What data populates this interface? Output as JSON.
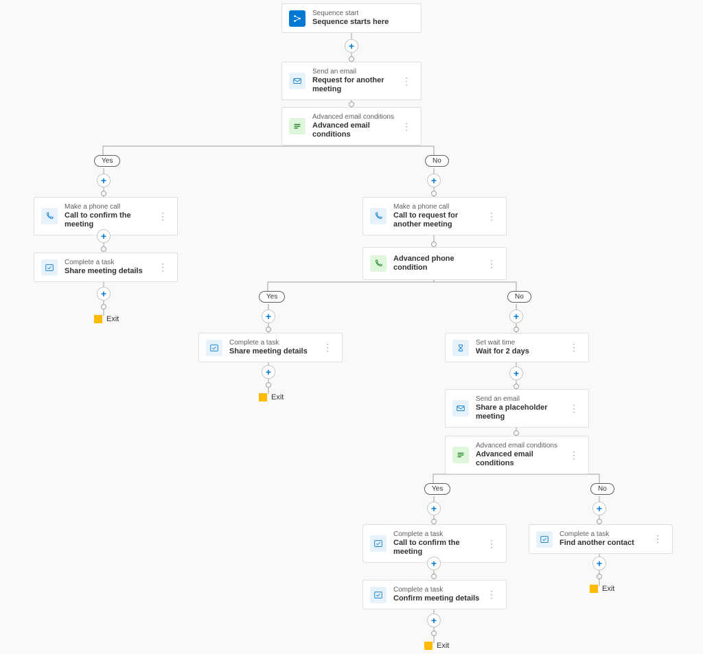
{
  "labels": {
    "yes": "Yes",
    "no": "No",
    "exit": "Exit"
  },
  "nodes": {
    "start": {
      "pre": "Sequence start",
      "title": "Sequence starts here"
    },
    "email1": {
      "pre": "Send an email",
      "title": "Request for another meeting"
    },
    "cond1": {
      "pre": "Advanced email conditions",
      "title": "Advanced email conditions"
    },
    "phone1": {
      "pre": "Make a phone call",
      "title": "Call to confirm the meeting"
    },
    "task1": {
      "pre": "Complete a task",
      "title": "Share meeting details"
    },
    "phone2": {
      "pre": "Make a phone call",
      "title": "Call to request for another meeting"
    },
    "cond2": {
      "title": "Advanced phone condition"
    },
    "task2": {
      "pre": "Complete a task",
      "title": "Share meeting details"
    },
    "wait1": {
      "pre": "Set wait time",
      "title": "Wait for 2 days"
    },
    "email2": {
      "pre": "Send an email",
      "title": "Share a placeholder meeting"
    },
    "cond3": {
      "pre": "Advanced email conditions",
      "title": "Advanced email conditions"
    },
    "task3": {
      "pre": "Complete a task",
      "title": "Call to confirm the meeting"
    },
    "task4": {
      "pre": "Complete a task",
      "title": "Confirm meeting details"
    },
    "task5": {
      "pre": "Complete a task",
      "title": "Find another contact"
    }
  }
}
